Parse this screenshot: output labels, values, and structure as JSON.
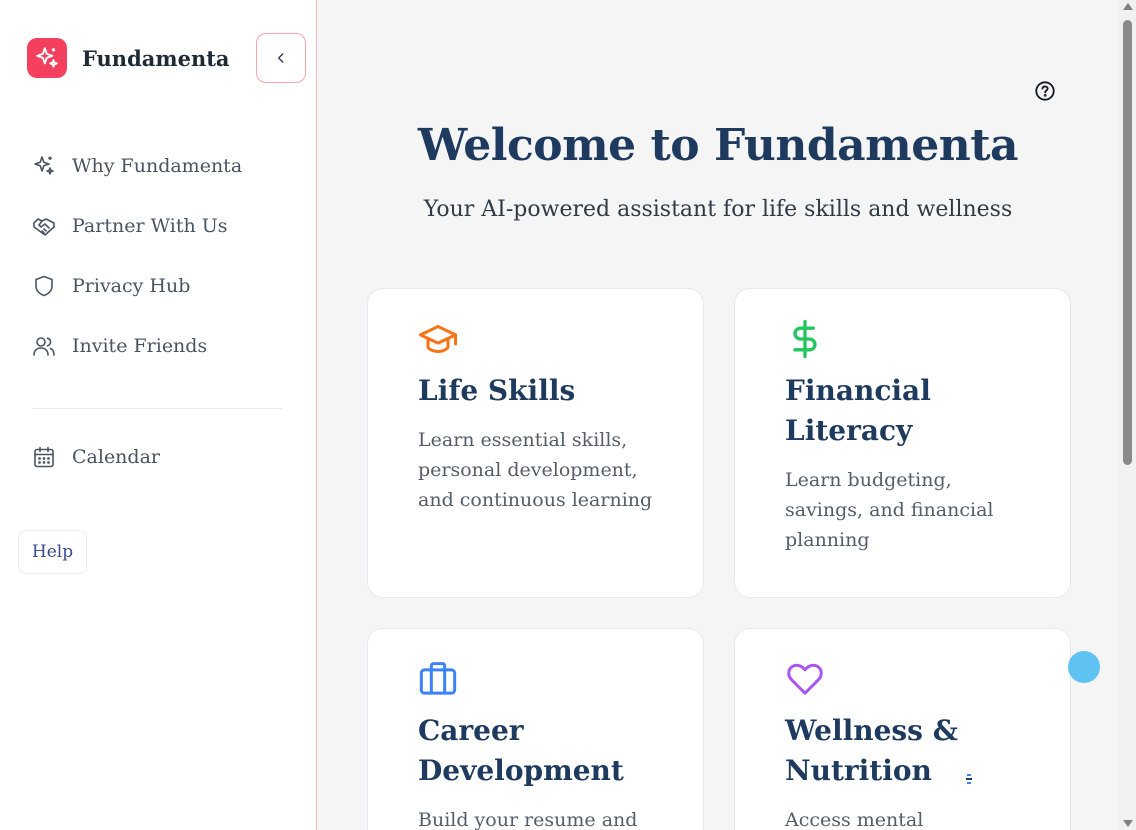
{
  "sidebar": {
    "brand": "Fundamenta",
    "items": [
      {
        "label": "Why Fundamenta",
        "icon": "sparkles-icon"
      },
      {
        "label": "Partner With Us",
        "icon": "handshake-icon"
      },
      {
        "label": "Privacy Hub",
        "icon": "shield-icon"
      },
      {
        "label": "Invite Friends",
        "icon": "users-icon"
      }
    ],
    "calendar": {
      "label": "Calendar",
      "icon": "calendar-icon"
    },
    "help_label": "Help"
  },
  "main": {
    "title": "Welcome to Fundamenta",
    "subtitle": "Your AI-powered assistant for life skills and wellness",
    "cards": [
      {
        "title": "Life Skills",
        "description": "Learn essential skills, personal development, and continuous learning",
        "icon": "graduation-cap-icon",
        "color": "#f97316"
      },
      {
        "title": "Financial Literacy",
        "description": "Learn budgeting, savings, and financial planning",
        "icon": "dollar-icon",
        "color": "#22c55e"
      },
      {
        "title": "Career Development",
        "description": "Build your resume and",
        "icon": "briefcase-icon",
        "color": "#3b82f6"
      },
      {
        "title": "Wellness & Nutrition",
        "description": "Access mental",
        "icon": "heart-icon",
        "color": "#a855f7"
      }
    ]
  },
  "colors": {
    "brand": "#f43f5e",
    "heading": "#1e3a5f",
    "background": "#f5f5f5"
  }
}
